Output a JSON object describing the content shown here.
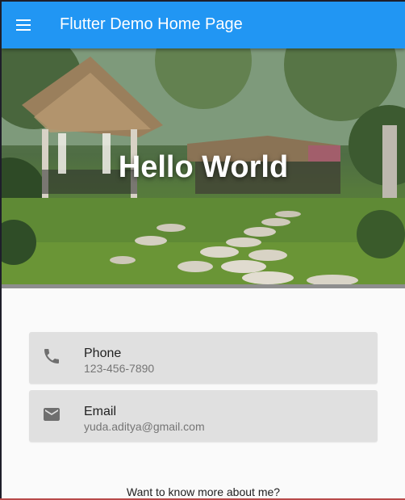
{
  "appbar": {
    "title": "Flutter Demo Home Page",
    "menu_icon": "menu-icon",
    "color": "#2196f3"
  },
  "hero": {
    "title": "Hello World"
  },
  "contacts": [
    {
      "title": "Phone",
      "subtitle": "123-456-7890",
      "icon": "phone-icon"
    },
    {
      "title": "Email",
      "subtitle": "yuda.aditya@gmail.com",
      "icon": "email-icon"
    }
  ],
  "footer": {
    "text": "Want to know more about me?"
  }
}
